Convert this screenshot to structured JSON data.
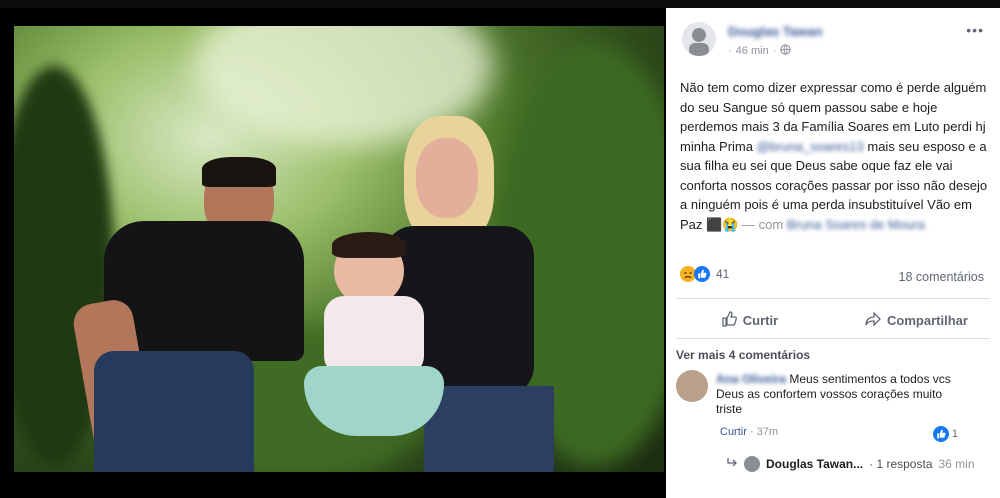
{
  "post": {
    "author": "Douglas Tawan",
    "timestamp": "46 min",
    "text": "Não tem como dizer expressar como é perde alguém do seu Sangue só quem passou sabe e hoje perdemos mais 3 da Família Soares em Luto perdi hj minha Prima",
    "tag_user": "@bruna_soares13",
    "text_2": "mais seu esposo e a sua filha eu sei que Deus sabe oque faz ele vai conforta nossos corações passar por isso não desejo a ninguém pois é uma perda insubstituível Vão em Paz",
    "with_label": "— com",
    "with_users": "Bruna Soares de Moura",
    "reactions_count": "41",
    "comments_count": "18 comentários",
    "like_label": "Curtir",
    "share_label": "Compartilhar"
  },
  "comments": {
    "see_more": "Ver mais 4 comentários",
    "first": {
      "author": "Ana Oliveira",
      "text": "Meus sentimentos a todos vcs Deus as confortem vossos corações muito triste",
      "like_label": "Curtir",
      "time": "37m",
      "likes": "1"
    },
    "reply": {
      "name": "Douglas Tawan...",
      "count": "· 1 resposta",
      "time": "36 min"
    }
  },
  "icons": [
    "globe-icon",
    "more-icon",
    "like-icon",
    "share-icon",
    "reply-arrow-icon",
    "sad-reaction-icon",
    "like-reaction-icon"
  ],
  "colors": {
    "link": "#385898",
    "muted": "#606770",
    "like_blue": "#1877f2",
    "sad_yellow": "#f7b125"
  }
}
